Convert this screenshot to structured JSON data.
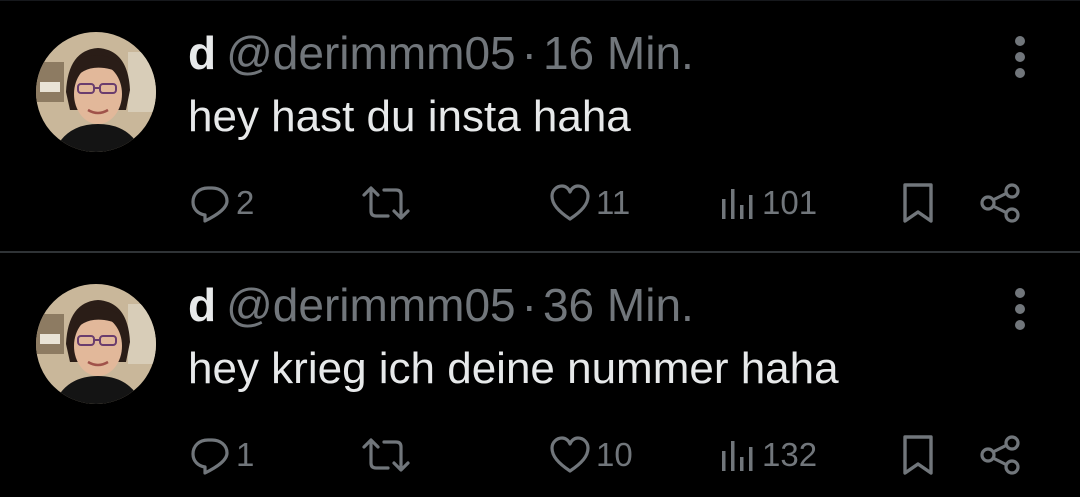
{
  "colors": {
    "background": "#000000",
    "primary_text": "#e7e9ea",
    "secondary_text": "#71767b",
    "divider": "#2f3336"
  },
  "tweets": [
    {
      "display_name": "d",
      "handle": "@derimmm05",
      "separator": "·",
      "time": "16 Min.",
      "text": "hey hast du insta haha",
      "replies": "2",
      "retweets": "",
      "likes": "11",
      "views": "101",
      "icons": [
        "reply-icon",
        "retweet-icon",
        "heart-icon",
        "views-icon",
        "bookmark-icon",
        "share-icon",
        "more-icon"
      ]
    },
    {
      "display_name": "d",
      "handle": "@derimmm05",
      "separator": "·",
      "time": "36 Min.",
      "text": "hey krieg ich deine nummer haha",
      "replies": "1",
      "retweets": "",
      "likes": "10",
      "views": "132",
      "icons": [
        "reply-icon",
        "retweet-icon",
        "heart-icon",
        "views-icon",
        "bookmark-icon",
        "share-icon",
        "more-icon"
      ]
    }
  ]
}
